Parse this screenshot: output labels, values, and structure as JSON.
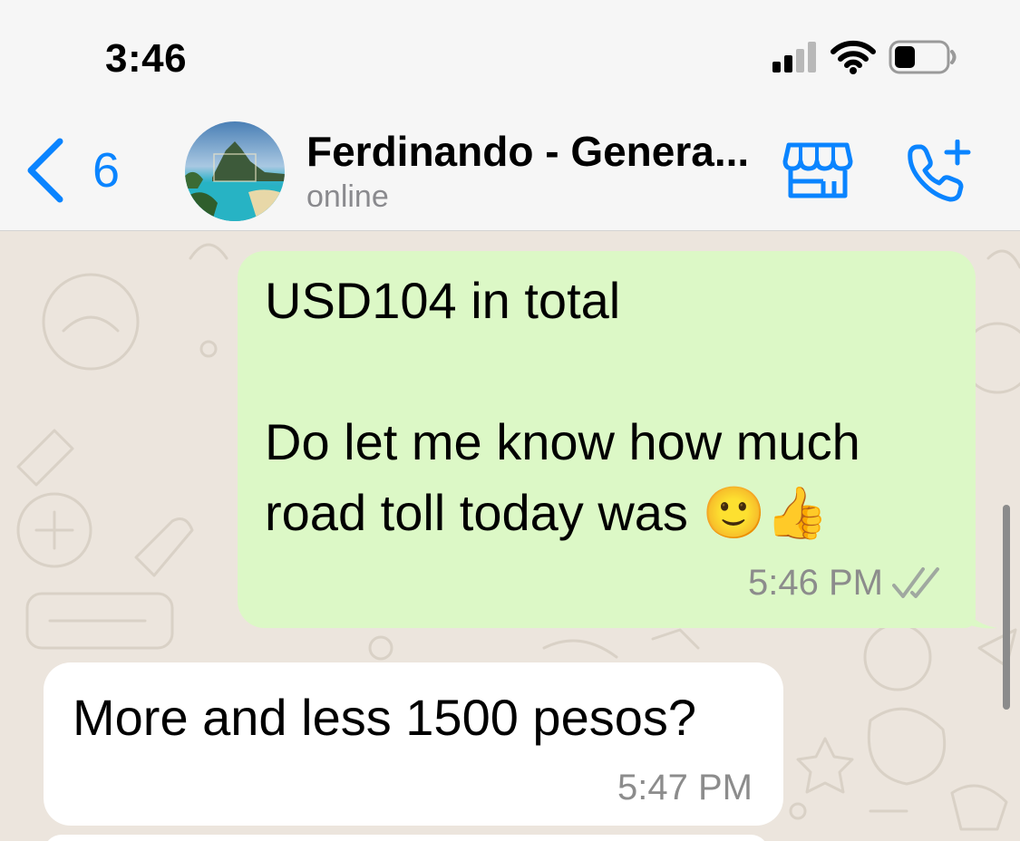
{
  "status_bar": {
    "time": "3:46",
    "icons": [
      "cellular-signal-icon",
      "wifi-icon",
      "battery-icon"
    ]
  },
  "header": {
    "back_count": "6",
    "contact_name": "Ferdinando - Genera...",
    "contact_status": "online",
    "icons": [
      "back-chevron-icon",
      "catalog-store-icon",
      "add-call-icon"
    ]
  },
  "messages": [
    {
      "direction": "outgoing",
      "text": "USD104 in total\n\nDo let me know how much\nroad toll today was 🙂👍",
      "time": "5:46 PM",
      "status_icon": "double-check-read-icon"
    },
    {
      "direction": "incoming",
      "text": "More and less 1500 pesos?",
      "time": "5:47 PM"
    }
  ],
  "colors": {
    "accent": "#0a84ff",
    "outgoing_bubble": "#dcf8c6",
    "incoming_bubble": "#ffffff",
    "chat_background": "#ece5dd",
    "timestamp": "#8c8c8c"
  }
}
